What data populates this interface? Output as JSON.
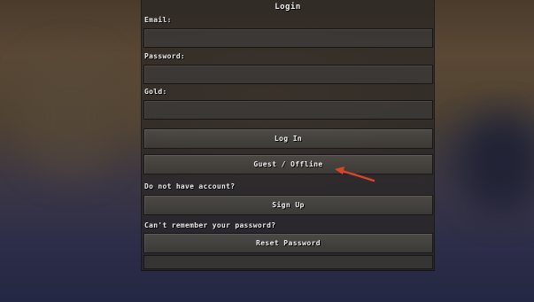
{
  "login": {
    "title": "Login",
    "email_label": "Email:",
    "email_value": "",
    "password_label": "Password:",
    "password_value": "",
    "gold_label": "Gold:",
    "gold_value": "",
    "login_button": "Log In",
    "guest_button": "Guest / Offline",
    "no_account_text": "Do not have account?",
    "signup_button": "Sign Up",
    "forgot_text": "Can't remember your password?",
    "reset_button": "Reset Password"
  },
  "annotation": {
    "arrow_icon": "red-arrow-icon",
    "arrow_color": "#d9452a"
  }
}
